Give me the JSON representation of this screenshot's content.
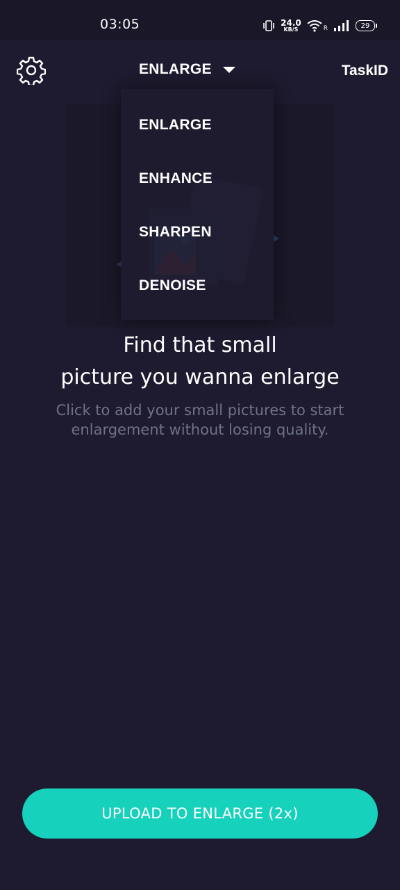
{
  "status_bar": {
    "time": "03:05",
    "net_speed_value": "24.0",
    "net_speed_unit": "KB/S",
    "roaming": "R",
    "battery": "29"
  },
  "app_bar": {
    "mode_selected": "ENLARGE",
    "task_id_label": "TaskID"
  },
  "dropdown": {
    "items": [
      "ENLARGE",
      "ENHANCE",
      "SHARPEN",
      "DENOISE"
    ]
  },
  "main": {
    "headline_line1": "Find that small",
    "headline_line2": "picture you wanna enlarge",
    "subtext_line1": "Click to add your small pictures to start",
    "subtext_line2": "enlargement without losing quality."
  },
  "upload_button_label": "UPLOAD TO ENLARGE (2x)",
  "colors": {
    "background": "#1e1a2f",
    "accent": "#16d1bb",
    "muted_text": "#6f7386"
  }
}
